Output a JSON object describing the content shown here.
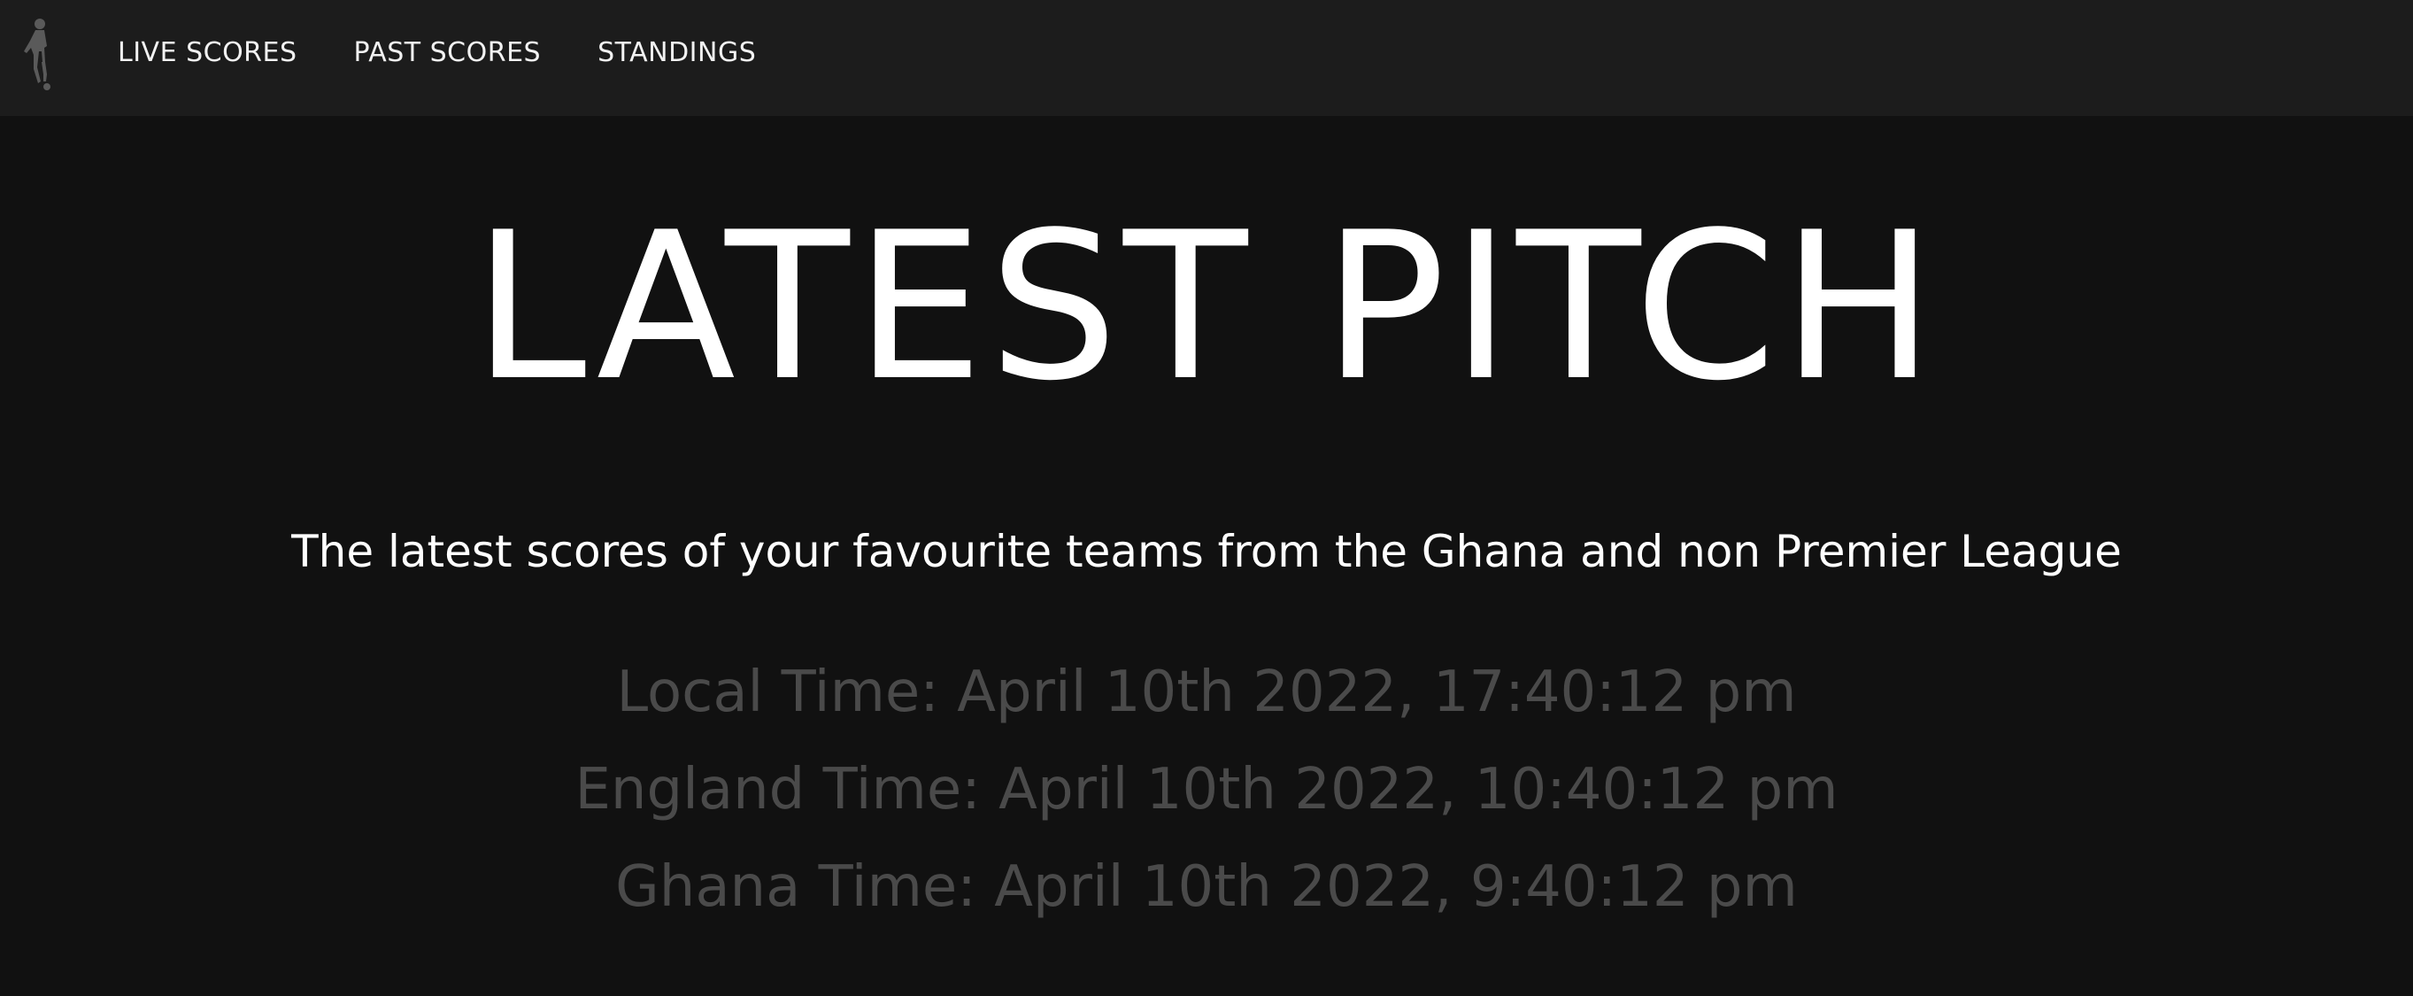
{
  "nav": {
    "logo_icon": "footballer-silhouette-icon",
    "items": [
      {
        "label": "LIVE SCORES"
      },
      {
        "label": "PAST SCORES"
      },
      {
        "label": "STANDINGS"
      }
    ]
  },
  "hero": {
    "title": "LATEST PITCH",
    "subtitle": "The latest scores of your favourite teams from the Ghana and non Premier League"
  },
  "times": {
    "local": "Local Time: April 10th 2022, 17:40:12 pm",
    "england": "England Time: April 10th 2022, 10:40:12 pm",
    "ghana": "Ghana Time: April 10th 2022, 9:40:12 pm"
  },
  "colors": {
    "background": "#111111",
    "navbar": "#1c1c1c",
    "text": "#ffffff",
    "muted_text": "#4a4a4a"
  }
}
